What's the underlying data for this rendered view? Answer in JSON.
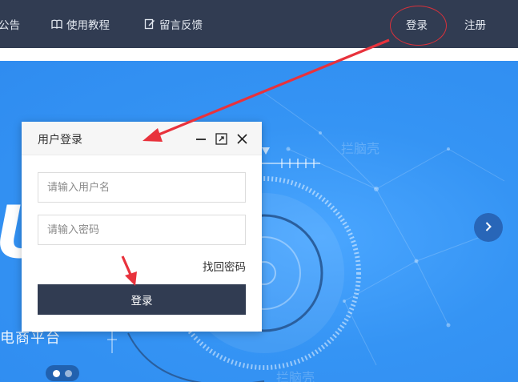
{
  "nav": {
    "announcement": "公告",
    "tutorial": "使用教程",
    "feedback": "留言反馈",
    "login": "登录",
    "register": "注册"
  },
  "hero": {
    "watermark_top": "拦脑壳",
    "watermark_bottom": "拦脑壳",
    "big_letter": "U",
    "subtitle": "电商平台"
  },
  "dialog": {
    "title": "用户登录",
    "username_placeholder": "请输入用户名",
    "password_placeholder": "请输入密码",
    "forgot": "找回密码",
    "submit": "登录"
  },
  "carousel": {
    "slides": 2,
    "active": 1
  },
  "colors": {
    "nav_bg": "#313c52",
    "hero_bg": "#2f8cf0",
    "button_bg": "#313c52",
    "annotation": "#e8323c"
  },
  "icons": {
    "tutorial": "book-icon",
    "feedback": "edit-icon",
    "minimize": "minimize-icon",
    "maximize": "maximize-icon",
    "close": "close-icon",
    "next": "chevron-right-icon"
  }
}
